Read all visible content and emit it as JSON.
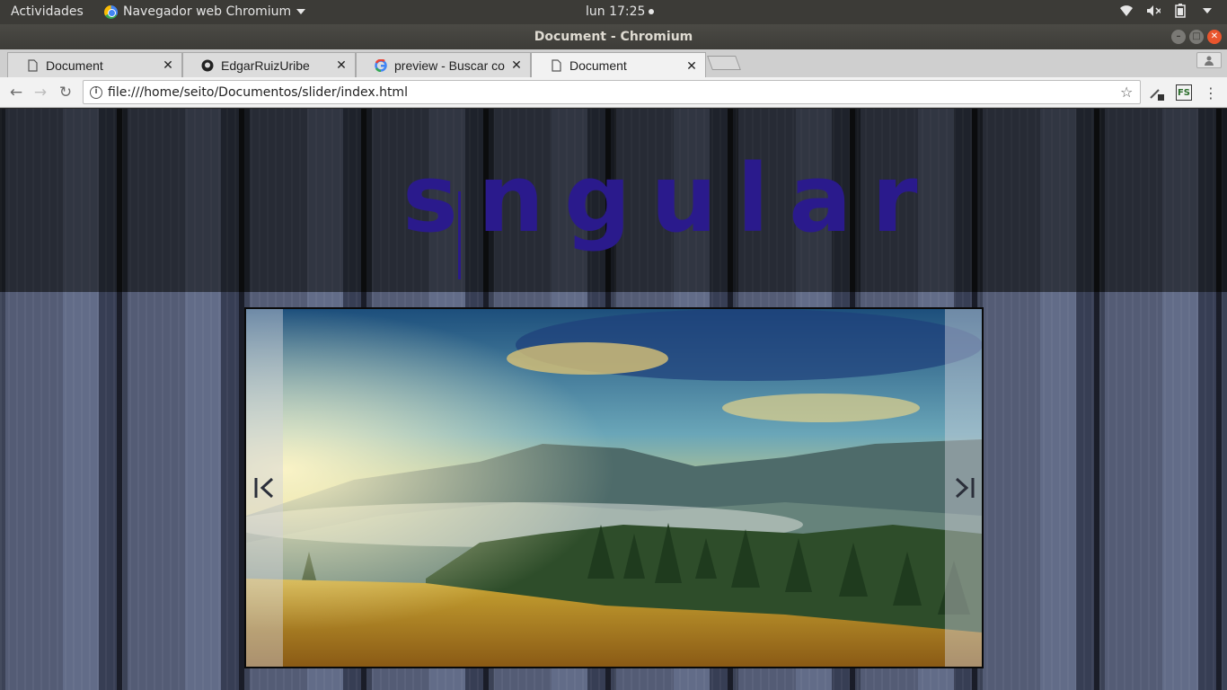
{
  "system_bar": {
    "activities": "Actividades",
    "app_menu": "Navegador web Chromium",
    "clock": "lun 17:25",
    "tray_icons": [
      "wifi-icon",
      "speaker-muted-icon",
      "battery-icon",
      "system-menu-icon"
    ]
  },
  "window": {
    "title": "Document - Chromium"
  },
  "tabs": [
    {
      "title": "Document",
      "icon": "document-icon",
      "active": false
    },
    {
      "title": "EdgarRuizUribe",
      "icon": "github-icon",
      "active": false
    },
    {
      "title": "preview - Buscar co",
      "icon": "google-icon",
      "active": false
    },
    {
      "title": "Document",
      "icon": "document-icon",
      "active": true
    }
  ],
  "toolbar": {
    "url": "file:///home/seito/Documentos/slider/index.html",
    "extensions": [
      "eyedropper-icon",
      "fs-extension-icon"
    ]
  },
  "page": {
    "logo_text": "sngular",
    "slider": {
      "prev_label": "|<",
      "next_label": ">|"
    }
  },
  "colors": {
    "logo": "#2a1a8c",
    "close_button": "#e9552d",
    "topbar": "#3c3b37"
  }
}
